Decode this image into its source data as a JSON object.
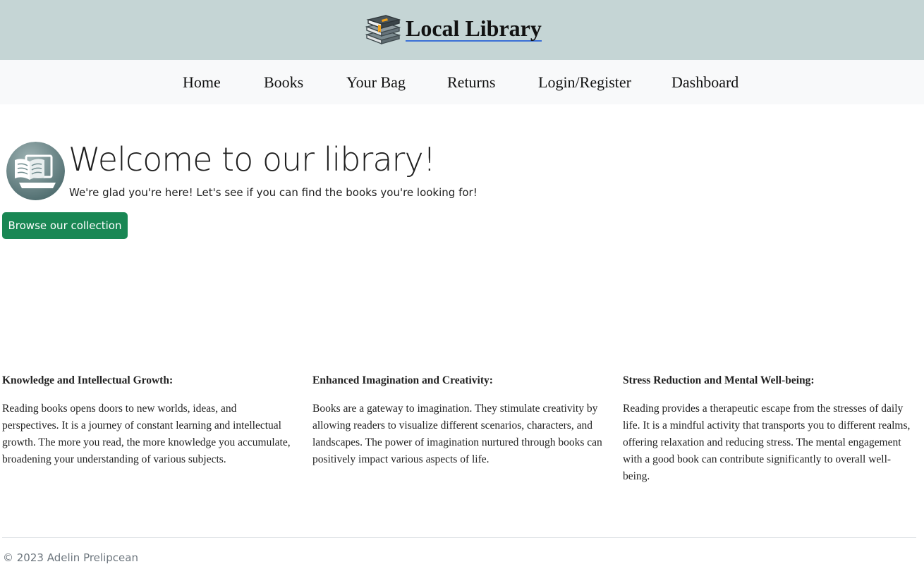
{
  "header": {
    "brand_title": "Local Library",
    "brand_icon": "stacked-books-icon",
    "background": "#c5d5d5"
  },
  "nav": {
    "items": [
      {
        "label": "Home"
      },
      {
        "label": "Books"
      },
      {
        "label": "Your Bag"
      },
      {
        "label": "Returns"
      },
      {
        "label": "Login/Register"
      },
      {
        "label": "Dashboard"
      }
    ]
  },
  "hero": {
    "logo_icon": "open-book-laptop-icon",
    "title": "Welcome to our library!",
    "subtitle": "We're glad you're here! Let's see if you can find the books you're looking for!",
    "button_label": "Browse our collection",
    "button_color": "#198754"
  },
  "features": [
    {
      "title": "Knowledge and Intellectual Growth:",
      "text": "Reading books opens doors to new worlds, ideas, and perspectives. It is a journey of constant learning and intellectual growth. The more you read, the more knowledge you accumulate, broadening your understanding of various subjects."
    },
    {
      "title": "Enhanced Imagination and Creativity:",
      "text": "Books are a gateway to imagination. They stimulate creativity by allowing readers to visualize different scenarios, characters, and landscapes. The power of imagination nurtured through books can positively impact various aspects of life."
    },
    {
      "title": "Stress Reduction and Mental Well-being:",
      "text": "Reading provides a therapeutic escape from the stresses of daily life. It is a mindful activity that transports you to different realms, offering relaxation and reducing stress. The mental engagement with a good book can contribute significantly to overall well-being."
    }
  ],
  "footer": {
    "text": "© 2023 Adelin Prelipcean"
  }
}
